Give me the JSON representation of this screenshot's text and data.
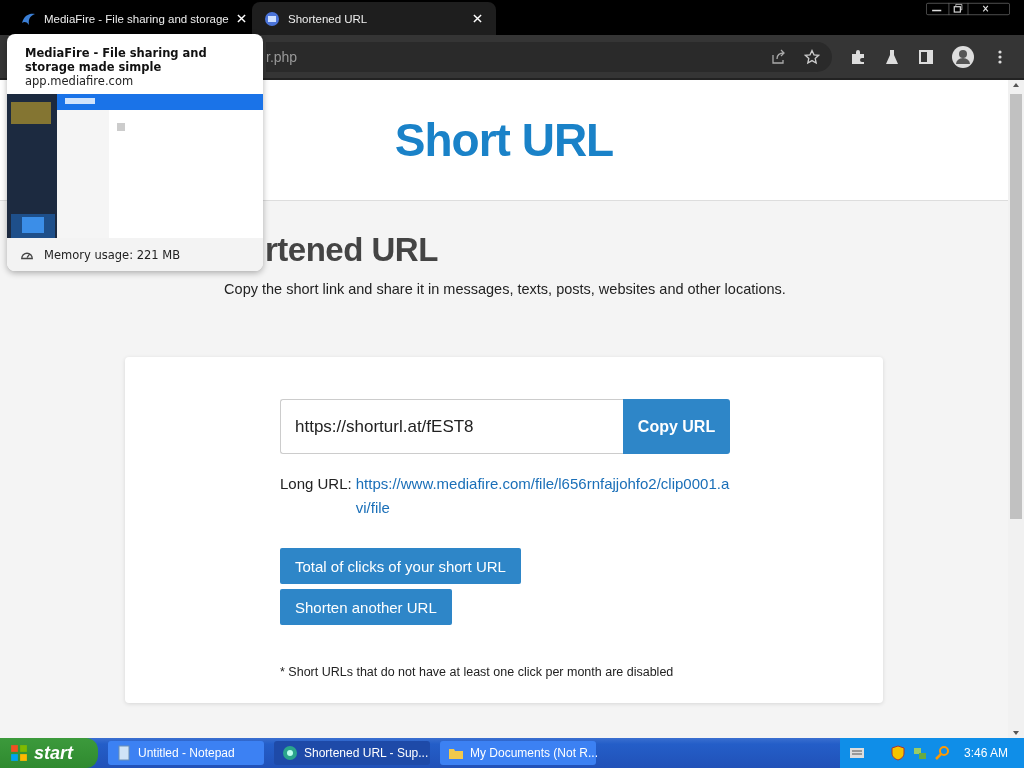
{
  "browser": {
    "tabs": [
      {
        "title": "MediaFire - File sharing and storage",
        "selected": false
      },
      {
        "title": "Shortened URL",
        "selected": true
      }
    ],
    "address": "r.php"
  },
  "tab_preview": {
    "title": "MediaFire - File sharing and storage made simple",
    "domain": "app.mediafire.com",
    "memory": "Memory usage: 221 MB"
  },
  "page": {
    "logo": "Short URL",
    "heading": "rtened URL",
    "intro": "Copy the short link and share it in messages, texts, posts, websites and other locations.",
    "short_url": "https://shorturl.at/fEST8",
    "copy_button": "Copy URL",
    "long_url_label": "Long URL:",
    "long_url": "https://www.mediafire.com/file/l656rnfajjohfo2/clip0001.avi/file",
    "buttons": [
      "Total of clicks of your short URL",
      "Shorten another URL"
    ],
    "note": "* Short URLs that do not have at least one click per month are disabled"
  },
  "taskbar": {
    "start": "start",
    "tasks": [
      {
        "label": "Untitled - Notepad",
        "selected": false,
        "kind": "notepad"
      },
      {
        "label": "Shortened URL - Sup...",
        "selected": true,
        "kind": "browser"
      },
      {
        "label": "My Documents (Not R...",
        "selected": false,
        "kind": "folder"
      }
    ],
    "clock": "3:46 AM"
  }
}
